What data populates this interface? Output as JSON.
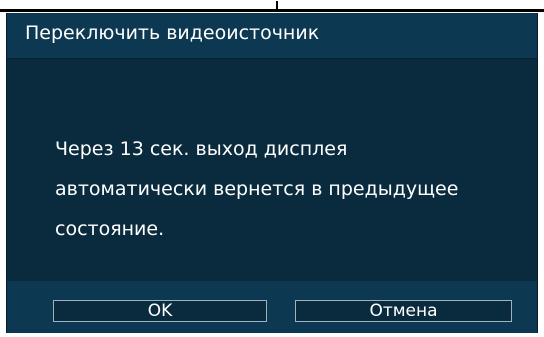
{
  "dialog": {
    "title": "Переключить видеоисточник",
    "message": {
      "line1": "Через 13 сек. выход дисплея",
      "line2": "автоматически вернется в предыдущее",
      "line3": "состояние."
    },
    "buttons": {
      "ok_label": "OK",
      "cancel_label": "Отмена"
    }
  },
  "colors": {
    "dialog_bg": "#0a2b3e",
    "titlebar_bg": "#0d3852",
    "text": "#ffffff",
    "button_border": "#9fb3bf"
  }
}
